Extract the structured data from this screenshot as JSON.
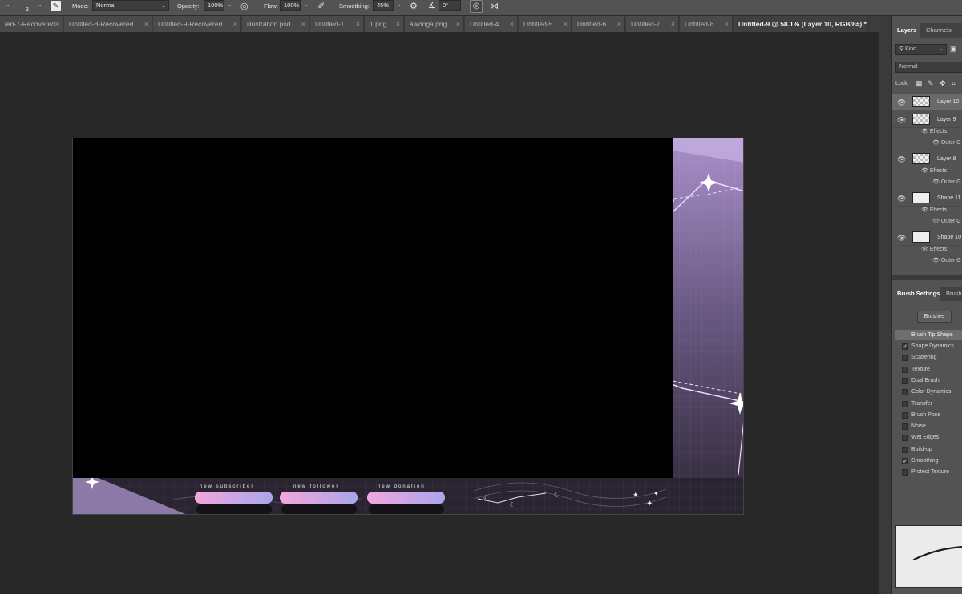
{
  "options_bar": {
    "brush_size": "3",
    "mode_label": "Mode:",
    "mode_value": "Normal",
    "opacity_label": "Opacity:",
    "opacity_value": "100%",
    "flow_label": "Flow:",
    "flow_value": "100%",
    "smoothing_label": "Smoothing:",
    "smoothing_value": "45%",
    "angle_value": "0°"
  },
  "tabs": [
    {
      "label": "led-7-Recovered"
    },
    {
      "label": "Untitled-8-Recovered"
    },
    {
      "label": "Untitled-9-Recovered"
    },
    {
      "label": "illustration.psd"
    },
    {
      "label": "Untitled-1"
    },
    {
      "label": "1.png"
    },
    {
      "label": "awooga.png"
    },
    {
      "label": "Untitled-4"
    },
    {
      "label": "Untitled-5"
    },
    {
      "label": "Untitled-6"
    },
    {
      "label": "Untitled-7"
    },
    {
      "label": "Untitled-8"
    },
    {
      "label": "Untitled-9 @ 58.1% (Layer 10, RGB/8#) *"
    }
  ],
  "overlay": {
    "labels": [
      "new subscriber",
      "new follower",
      "new donation"
    ],
    "accent": "#b48fe0"
  },
  "layers_panel": {
    "tab_layers": "Layers",
    "tab_channels": "Channels",
    "filter_kind": "Kind",
    "blend_mode": "Normal",
    "lock_label": "Lock:",
    "layers": [
      {
        "name": "Layer 10"
      },
      {
        "name": "Layer 9",
        "effects": "Effects",
        "effect": "Outer G"
      },
      {
        "name": "Layer 8",
        "effects": "Effects",
        "effect": "Outer G"
      },
      {
        "name": "Shape 11",
        "effects": "Effects",
        "effect": "Outer G"
      },
      {
        "name": "Shape 10",
        "effects": "Effects",
        "effect": "Outer G"
      }
    ]
  },
  "brush_panel": {
    "tab_brush_settings": "Brush Settings",
    "tab_brushes_short": "Brush",
    "brushes_button": "Brushes",
    "tip_shape": "Brush Tip Shape",
    "options": [
      {
        "label": "Shape Dynamics",
        "checked": true
      },
      {
        "label": "Scattering",
        "checked": false
      },
      {
        "label": "Texture",
        "checked": false
      },
      {
        "label": "Dual Brush",
        "checked": false
      },
      {
        "label": "Color Dynamics",
        "checked": false
      },
      {
        "label": "Transfer",
        "checked": false
      },
      {
        "label": "Brush Pose",
        "checked": false
      },
      {
        "label": "Noise",
        "checked": false
      },
      {
        "label": "Wet Edges",
        "checked": false
      },
      {
        "label": "Build-up",
        "checked": false
      },
      {
        "label": "Smoothing",
        "checked": true
      },
      {
        "label": "Protect Texture",
        "checked": false
      }
    ]
  }
}
